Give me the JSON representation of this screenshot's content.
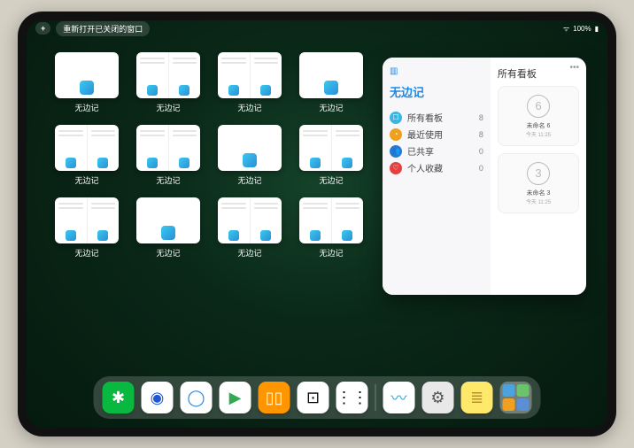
{
  "status": {
    "time": "",
    "battery": "100%",
    "signal": "•••"
  },
  "toolbar": {
    "plus": "+",
    "reopen_label": "重新打开已关闭的窗口"
  },
  "app_thumbnails": [
    {
      "label": "无边记",
      "variant": "blank"
    },
    {
      "label": "无边记",
      "variant": "content"
    },
    {
      "label": "无边记",
      "variant": "content"
    },
    {
      "label": "无边记",
      "variant": "blank"
    },
    {
      "label": "无边记",
      "variant": "content"
    },
    {
      "label": "无边记",
      "variant": "content"
    },
    {
      "label": "无边记",
      "variant": "blank"
    },
    {
      "label": "无边记",
      "variant": "content"
    },
    {
      "label": "无边记",
      "variant": "content"
    },
    {
      "label": "无边记",
      "variant": "blank"
    },
    {
      "label": "无边记",
      "variant": "content"
    },
    {
      "label": "无边记",
      "variant": "content"
    }
  ],
  "popup": {
    "app_title": "无边记",
    "categories": [
      {
        "icon_bg": "#3ab6e5",
        "glyph": "☐",
        "label": "所有看板",
        "count": "8"
      },
      {
        "icon_bg": "#f0a020",
        "glyph": "◔",
        "label": "最近使用",
        "count": "8"
      },
      {
        "icon_bg": "#2a78d6",
        "glyph": "👥",
        "label": "已共享",
        "count": "0"
      },
      {
        "icon_bg": "#e54040",
        "glyph": "♡",
        "label": "个人收藏",
        "count": "0"
      }
    ],
    "right_title": "所有看板",
    "boards": [
      {
        "sketch": "6",
        "name": "未命名 6",
        "time": "今天 11:25"
      },
      {
        "sketch": "3",
        "name": "未命名 3",
        "time": "今天 11:25"
      }
    ]
  },
  "dock": [
    {
      "name": "wechat",
      "bg": "#09b83e",
      "glyph": "✱",
      "fg": "#fff"
    },
    {
      "name": "browser-blue",
      "bg": "#ffffff",
      "glyph": "◉",
      "fg": "#1e56d6"
    },
    {
      "name": "qq-browser",
      "bg": "#ffffff",
      "glyph": "◯",
      "fg": "#1e88e5"
    },
    {
      "name": "play-store",
      "bg": "#ffffff",
      "glyph": "▶",
      "fg": "#34a853"
    },
    {
      "name": "books",
      "bg": "#ff9500",
      "glyph": "▯▯",
      "fg": "#fff"
    },
    {
      "name": "dice",
      "bg": "#ffffff",
      "glyph": "⊡",
      "fg": "#000"
    },
    {
      "name": "nodes",
      "bg": "#ffffff",
      "glyph": "⋮⋮",
      "fg": "#000"
    }
  ],
  "dock_recent": [
    {
      "name": "freeform",
      "bg": "#ffffff",
      "glyph": "〰",
      "fg": "#2aa5d6"
    },
    {
      "name": "settings",
      "bg": "#e8e8e8",
      "glyph": "⚙",
      "fg": "#555"
    },
    {
      "name": "notes",
      "bg": "#ffe96b",
      "glyph": "≣",
      "fg": "#b89028"
    }
  ]
}
